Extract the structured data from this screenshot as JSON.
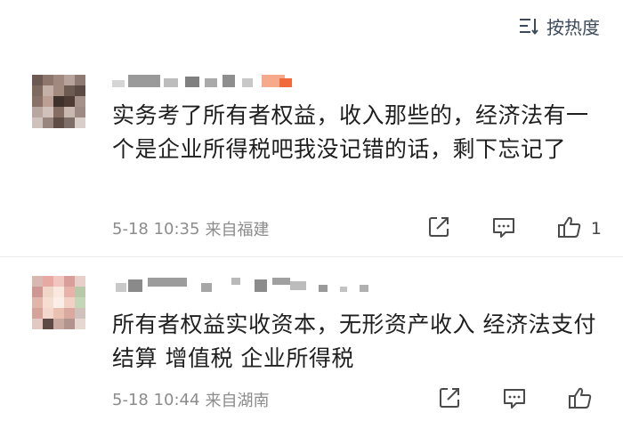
{
  "sort": {
    "label": "按热度",
    "icon": "sort-lines-icon"
  },
  "comments": [
    {
      "text": "实务考了所有者权益，收入那些的，经济法有一个是企业所得税吧我没记错的话，剩下忘记了",
      "time": "5-18 10:35",
      "location": "来自福建",
      "likes": "1"
    },
    {
      "text": "所有者权益实收资本，无形资产收入 经济法支付结算 增值税 企业所得税",
      "time": "5-18 10:44",
      "location": "来自湖南",
      "likes": ""
    }
  ],
  "colors": {
    "meta": "#8c8c8c",
    "icons": "#4a4a4a"
  }
}
